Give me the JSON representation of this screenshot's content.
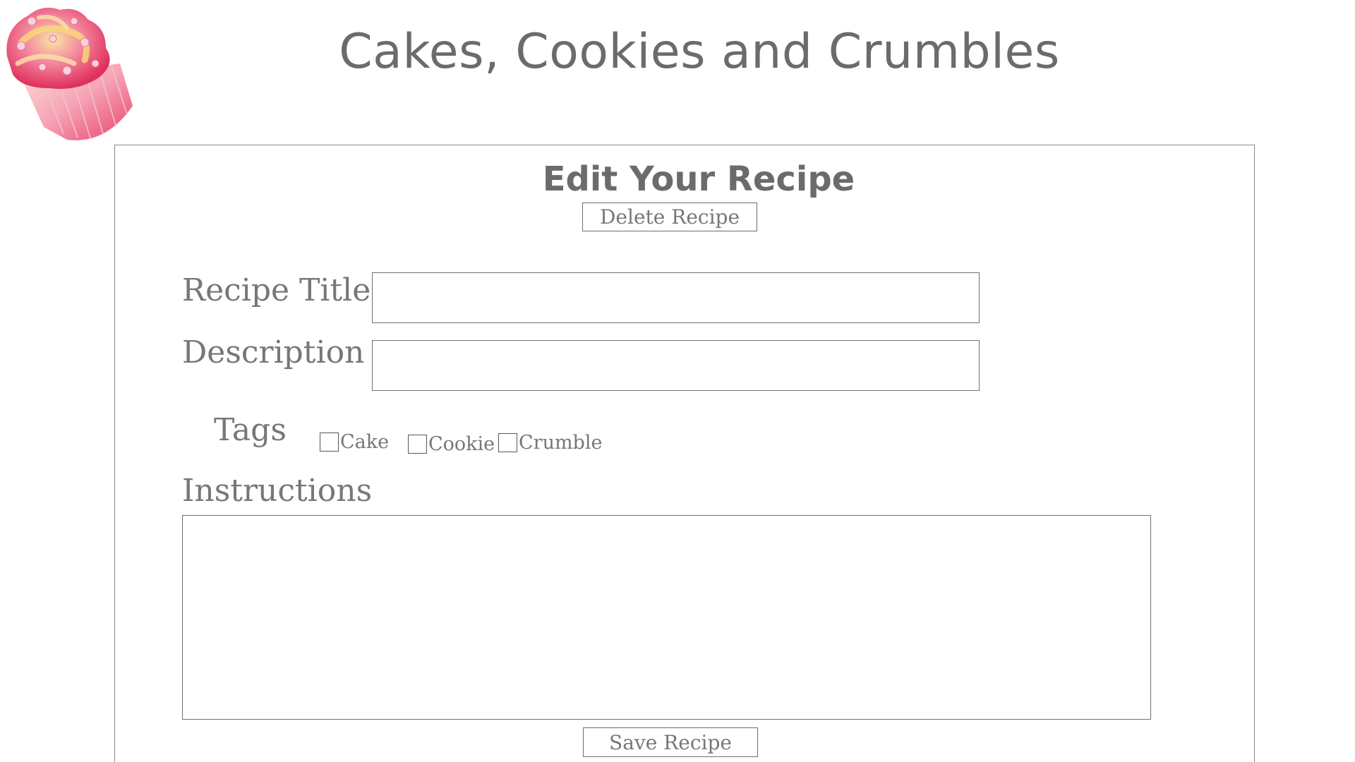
{
  "site": {
    "title": "Cakes, Cookies and Crumbles"
  },
  "panel": {
    "title": "Edit Your Recipe",
    "delete_button": "Delete Recipe",
    "save_button": "Save Recipe"
  },
  "form": {
    "recipe_title_label": "Recipe Title",
    "recipe_title_value": "",
    "description_label": "Description",
    "description_value": "",
    "tags_label": "Tags",
    "tags": [
      {
        "label": "Cake",
        "checked": false
      },
      {
        "label": "Cookie",
        "checked": false
      },
      {
        "label": "Crumble",
        "checked": false
      }
    ],
    "instructions_label": "Instructions",
    "instructions_value": ""
  },
  "colors": {
    "text": "#6e6e6e",
    "border": "#6f6f6f",
    "background": "#ffffff",
    "frosting_pink": "#e8406b",
    "frosting_yellow": "#f5d36b",
    "cupcake_liner": "#f07a98"
  },
  "icons": {
    "logo": "cupcake-logo"
  }
}
